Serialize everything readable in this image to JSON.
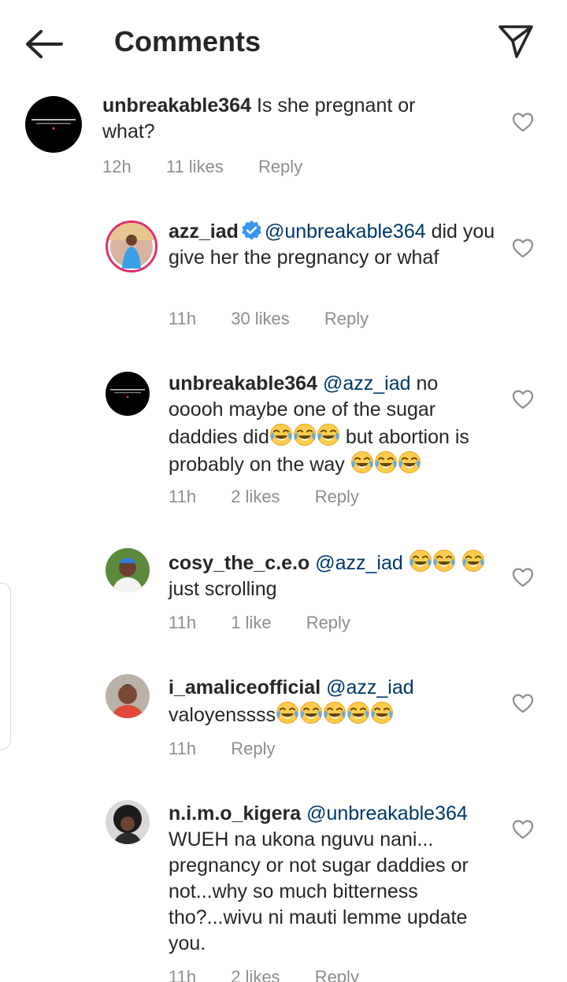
{
  "header": {
    "title": "Comments",
    "back_icon": "arrow-left-icon",
    "share_icon": "paper-plane-icon"
  },
  "comments": [
    {
      "user": "unbreakable364",
      "verified": false,
      "mention": "",
      "text": "Is she pregnant or what?",
      "time": "12h",
      "likes": "11 likes",
      "reply": "Reply",
      "avatar_text": "Your opinion of yourself determines your reality",
      "emoji_count": 0
    },
    {
      "user": "azz_iad",
      "verified": true,
      "mention": "@unbreakable364",
      "text": "did you give her the pregnancy or whaf",
      "time": "11h",
      "likes": "30 likes",
      "reply": "Reply",
      "emoji_count": 0
    },
    {
      "user": "unbreakable364",
      "mention": "@azz_iad",
      "text_a": "no ooooh maybe one of the sugar daddies did",
      "text_b": "but abortion is probably on the way",
      "emoji": "😂",
      "time": "11h",
      "likes": "2 likes",
      "reply": "Reply",
      "avatar_text": "Your opinion of yourself determines your reality",
      "emoji_count_a": 3,
      "emoji_count_b": 3
    },
    {
      "user": "cosy_the_c.e.o",
      "mention": "@azz_iad",
      "text": "just scrolling",
      "emoji": "😂",
      "time": "11h",
      "likes": "1 like",
      "reply": "Reply",
      "emoji_count_a": 2,
      "emoji_count_b": 1
    },
    {
      "user": "i_amaliceofficial",
      "mention": "@azz_iad",
      "text": "valoyenssss",
      "emoji": "😂",
      "time": "11h",
      "reply": "Reply",
      "emoji_count": 5
    },
    {
      "user": "n.i.m.o_kigera",
      "mention": "@unbreakable364",
      "text": "WUEH na ukona nguvu nani... pregnancy or not sugar daddies or not...why so much bitterness tho?...wivu ni mauti lemme update you.",
      "time": "11h",
      "likes": "2 likes",
      "reply": "Reply"
    }
  ],
  "colors": {
    "text": "#262626",
    "meta": "#8e8e8e",
    "mention": "#00376b",
    "verified": "#3897f0"
  }
}
